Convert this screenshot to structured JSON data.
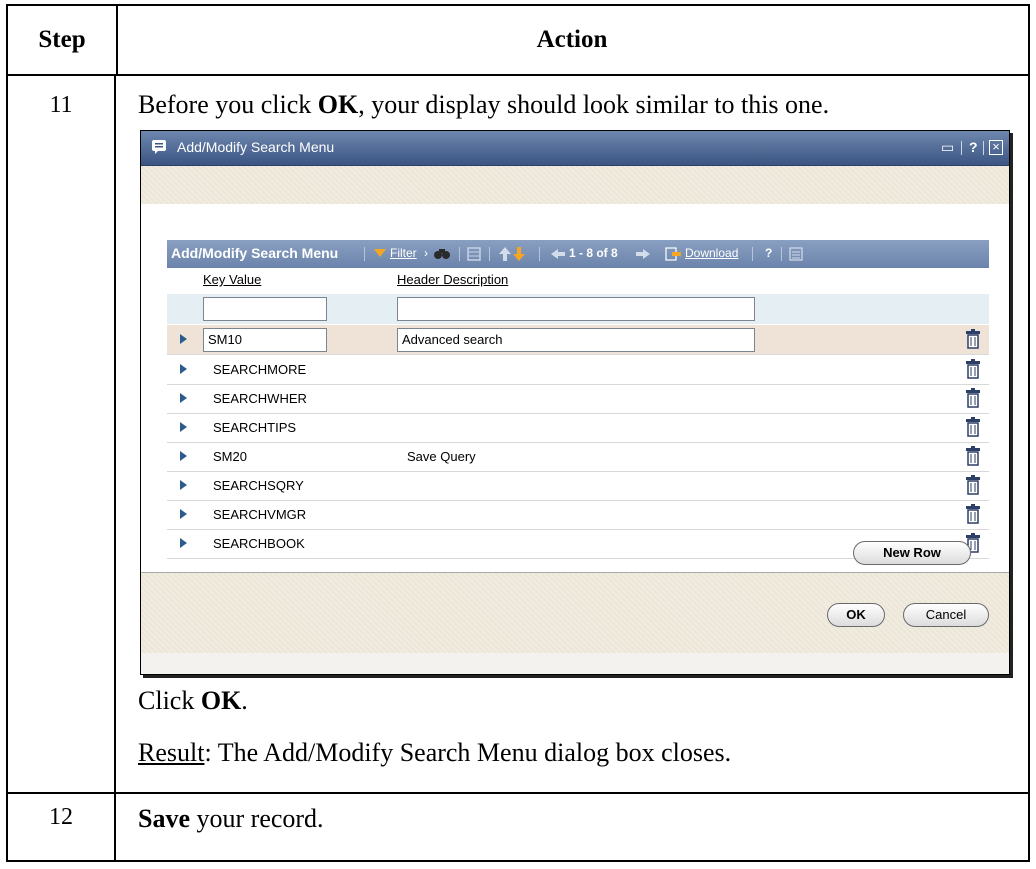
{
  "table": {
    "header": {
      "step": "Step",
      "action": "Action"
    },
    "rows": [
      {
        "step": "11",
        "intro_before": "Before you click ",
        "intro_bold": "OK",
        "intro_after": ", your display should look similar to this one.",
        "click_prefix": "Click ",
        "click_bold": "OK",
        "click_suffix": ".",
        "result_label": "Result",
        "result_text": ": The Add/Modify Search Menu dialog box closes."
      },
      {
        "step": "12",
        "action_bold": "Save",
        "action_text": " your record."
      }
    ]
  },
  "dialog": {
    "title": "Add/Modify Search Menu",
    "title_controls": {
      "minimize": "▭",
      "help": "?",
      "close": "×"
    },
    "grid": {
      "title": "Add/Modify Search Menu",
      "filter_label": "Filter",
      "pagination": "1 - 8 of 8",
      "download_label": "Download",
      "help": "?",
      "columns": [
        "Key Value",
        "Header Description"
      ],
      "filter_values": {
        "key": "",
        "desc": ""
      },
      "rows": [
        {
          "key": "SM10",
          "desc": "Advanced search",
          "selected": true
        },
        {
          "key": "SEARCHMORE",
          "desc": ""
        },
        {
          "key": "SEARCHWHER",
          "desc": ""
        },
        {
          "key": "SEARCHTIPS",
          "desc": ""
        },
        {
          "key": "SM20",
          "desc": "Save Query"
        },
        {
          "key": "SEARCHSQRY",
          "desc": ""
        },
        {
          "key": "SEARCHVMGR",
          "desc": ""
        },
        {
          "key": "SEARCHBOOK",
          "desc": ""
        }
      ]
    },
    "buttons": {
      "new_row": "New Row",
      "ok": "OK",
      "cancel": "Cancel"
    },
    "colors": {
      "titlebar": "#3b5584",
      "grid_header": "#7b92b8",
      "selected_row": "#efe3d7",
      "row_arrow": "#2c5c8e"
    }
  }
}
